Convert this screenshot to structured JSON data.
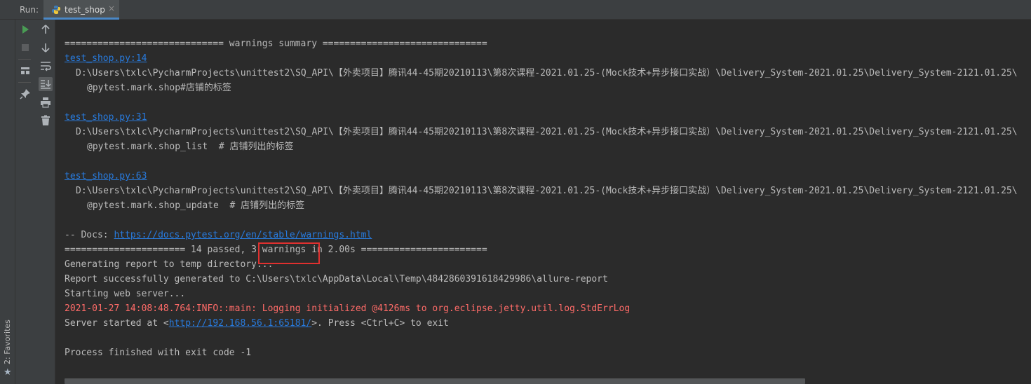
{
  "runbar": {
    "label": "Run:",
    "tab": {
      "label": "test_shop",
      "close": "×",
      "icon": "python-icon"
    }
  },
  "left_strip": {
    "favorites": {
      "label": "2: Favorites",
      "icon": "star-icon",
      "star": "★"
    }
  },
  "toolbar": {
    "col1": [
      "rerun-icon",
      "stop-icon",
      "layout-icon",
      "pin-icon"
    ],
    "col2": [
      "up-arrow-icon",
      "down-arrow-icon",
      "soft-wrap-icon",
      "scroll-to-end-icon",
      "print-icon",
      "trash-icon"
    ]
  },
  "console": {
    "summary_header": "============================= warnings summary ==============================",
    "warnings": [
      {
        "link": "test_shop.py:14",
        "path": "D:\\Users\\txlc\\PycharmProjects\\unittest2\\SQ_API\\【外卖项目】腾讯44-45期20210113\\第8次课程-2021.01.25-(Mock技术+异步接口实战）\\Delivery_System-2021.01.25\\Delivery_System-2121.01.25\\",
        "code": "@pytest.mark.shop#店铺的标签"
      },
      {
        "link": "test_shop.py:31",
        "path": "D:\\Users\\txlc\\PycharmProjects\\unittest2\\SQ_API\\【外卖项目】腾讯44-45期20210113\\第8次课程-2021.01.25-(Mock技术+异步接口实战）\\Delivery_System-2021.01.25\\Delivery_System-2121.01.25\\",
        "code": "@pytest.mark.shop_list  # 店铺列出的标签"
      },
      {
        "link": "test_shop.py:63",
        "path": "D:\\Users\\txlc\\PycharmProjects\\unittest2\\SQ_API\\【外卖项目】腾讯44-45期20210113\\第8次课程-2021.01.25-(Mock技术+异步接口实战）\\Delivery_System-2021.01.25\\Delivery_System-2121.01.25\\",
        "code": "@pytest.mark.shop_update  # 店铺列出的标签"
      }
    ],
    "docs_prefix": "-- Docs: ",
    "docs_link": "https://docs.pytest.org/en/stable/warnings.html",
    "result_line": "====================== 14 passed, 3 warnings in 2.00s =======================",
    "generating": "Generating report to temp directory...",
    "report_generated": "Report successfully generated to C:\\Users\\txlc\\AppData\\Local\\Temp\\4842860391618429986\\allure-report",
    "starting": "Starting web server...",
    "jetty_log": "2021-01-27 14:08:48.764:INFO::main: Logging initialized @4126ms to org.eclipse.jetty.util.log.StdErrLog",
    "server_prefix": "Server started at <",
    "server_link": "http://192.168.56.1:65181/",
    "server_suffix": ">. Press <Ctrl+C> to exit",
    "process_finished": "Process finished with exit code -1"
  },
  "colors": {
    "background": "#2b2b2b",
    "text": "#bbbbbb",
    "link": "#287bde",
    "error": "#ff6b68",
    "highlight_box": "#e0302f",
    "run_green": "#499c54"
  }
}
